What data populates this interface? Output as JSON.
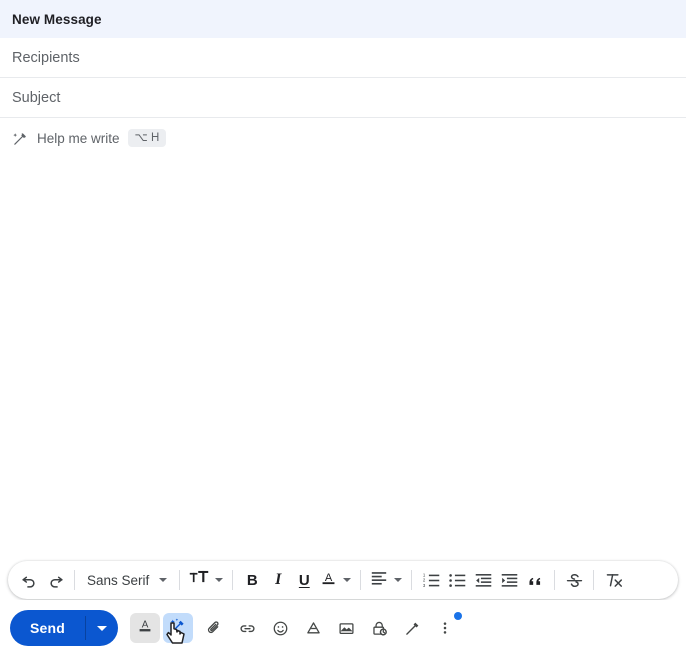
{
  "window": {
    "title": "New Message"
  },
  "fields": {
    "recipients_placeholder": "Recipients",
    "subject_placeholder": "Subject",
    "recipients_value": "",
    "subject_value": "",
    "body_value": ""
  },
  "help_me_write": {
    "label": "Help me write",
    "shortcut": "⌥ H",
    "icon": "magic-pen-icon"
  },
  "format_toolbar": {
    "items": [
      {
        "name": "undo-button",
        "label": "Undo",
        "icon": "undo-icon"
      },
      {
        "name": "redo-button",
        "label": "Redo",
        "icon": "redo-icon"
      },
      {
        "name": "font-family-dropdown",
        "label": "Sans Serif",
        "icon": "chevron-down-icon"
      },
      {
        "name": "font-size-dropdown",
        "label": "Size",
        "icon": "font-size-icon"
      },
      {
        "name": "bold-button",
        "label": "B",
        "icon": "bold-icon"
      },
      {
        "name": "italic-button",
        "label": "I",
        "icon": "italic-icon"
      },
      {
        "name": "underline-button",
        "label": "U",
        "icon": "underline-icon"
      },
      {
        "name": "text-color-dropdown",
        "label": "A",
        "icon": "text-color-icon"
      },
      {
        "name": "align-dropdown",
        "label": "Align",
        "icon": "align-left-icon"
      },
      {
        "name": "numbered-list-button",
        "label": "Numbered list",
        "icon": "numbered-list-icon"
      },
      {
        "name": "bulleted-list-button",
        "label": "Bulleted list",
        "icon": "bulleted-list-icon"
      },
      {
        "name": "indent-less-button",
        "label": "Indent less",
        "icon": "indent-less-icon"
      },
      {
        "name": "indent-more-button",
        "label": "Indent more",
        "icon": "indent-more-icon"
      },
      {
        "name": "quote-button",
        "label": "Quote",
        "icon": "quote-icon"
      },
      {
        "name": "strikethrough-button",
        "label": "Strikethrough",
        "icon": "strikethrough-icon"
      },
      {
        "name": "remove-formatting-button",
        "label": "Remove formatting",
        "icon": "remove-formatting-icon"
      }
    ],
    "font_family": "Sans Serif"
  },
  "bottom_bar": {
    "send_label": "Send",
    "send_options_label": "More send options",
    "actions": [
      {
        "name": "formatting-options-button",
        "label": "Formatting options",
        "icon": "text-format-icon",
        "state": "active"
      },
      {
        "name": "help-me-write-button",
        "label": "Help me write",
        "icon": "magic-pen-icon",
        "state": "hovered"
      },
      {
        "name": "attach-files-button",
        "label": "Attach files",
        "icon": "paperclip-icon",
        "state": "default"
      },
      {
        "name": "insert-link-button",
        "label": "Insert link",
        "icon": "link-icon",
        "state": "default"
      },
      {
        "name": "insert-emoji-button",
        "label": "Insert emoji",
        "icon": "emoji-icon",
        "state": "default"
      },
      {
        "name": "insert-drive-button",
        "label": "Insert files using Drive",
        "icon": "drive-icon",
        "state": "default"
      },
      {
        "name": "insert-photo-button",
        "label": "Insert photo",
        "icon": "image-icon",
        "state": "default"
      },
      {
        "name": "confidential-mode-button",
        "label": "Toggle confidential mode",
        "icon": "lock-clock-icon",
        "state": "default"
      },
      {
        "name": "insert-signature-button",
        "label": "Insert signature",
        "icon": "pen-icon",
        "state": "default"
      },
      {
        "name": "more-options-button",
        "label": "More options",
        "icon": "kebab-menu-icon",
        "state": "badge"
      }
    ]
  },
  "colors": {
    "header_bg": "#f0f4fd",
    "send_blue": "#0b57d0",
    "active_blue": "#c2dcfb",
    "active_grey": "#e4e4e4",
    "notification_blue": "#1a73e8",
    "icon_grey": "#444746",
    "label_grey": "#5f6368"
  }
}
